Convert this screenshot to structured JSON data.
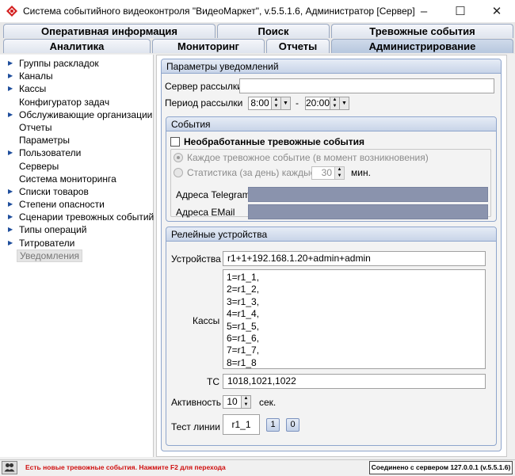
{
  "window": {
    "title": "Система событийного видеоконтроля \"ВидеоМаркет\", v.5.5.1.6, Администратор  [Сервер]",
    "minimize": "–",
    "maximize": "☐",
    "close": "✕"
  },
  "tabs_row1": [
    "Оперативная информация",
    "Поиск",
    "Тревожные события"
  ],
  "tabs_row2": [
    "Аналитика",
    "Мониторинг",
    "Отчеты",
    "Администрирование"
  ],
  "active_tab": "Администрирование",
  "sidebar": {
    "items": [
      {
        "label": "Группы раскладок",
        "arrow": true
      },
      {
        "label": "Каналы",
        "arrow": true
      },
      {
        "label": "Кассы",
        "arrow": true
      },
      {
        "label": "Конфигуратор задач",
        "arrow": false
      },
      {
        "label": "Обслуживающие организации",
        "arrow": true
      },
      {
        "label": "Отчеты",
        "arrow": false
      },
      {
        "label": "Параметры",
        "arrow": false
      },
      {
        "label": "Пользователи",
        "arrow": true
      },
      {
        "label": "Серверы",
        "arrow": false
      },
      {
        "label": "Система мониторинга",
        "arrow": false
      },
      {
        "label": "Списки товаров",
        "arrow": true
      },
      {
        "label": "Степени опасности",
        "arrow": true
      },
      {
        "label": "Сценарии тревожных событий",
        "arrow": true
      },
      {
        "label": "Типы операций",
        "arrow": true
      },
      {
        "label": "Титрователи",
        "arrow": true
      },
      {
        "label": "Уведомления",
        "arrow": false,
        "selected": true
      }
    ]
  },
  "notifications": {
    "header": "Параметры уведомлений",
    "server_label": "Сервер рассылки",
    "server_value": "",
    "period_label": "Период рассылки",
    "period_from": "8:00",
    "period_dash": "-",
    "period_to": "20:00"
  },
  "events": {
    "header": "События",
    "unprocessed_label": "Необработанные тревожные события",
    "unprocessed_checked": false,
    "each_label": "Каждое тревожное событие (в момент возникновения)",
    "stats_label": "Статистика (за день) каждые",
    "stats_value": "30",
    "stats_unit": "мин.",
    "telegram_label": "Адреса Telegram",
    "email_label": "Адреса EMail"
  },
  "relay": {
    "header": "Релейные устройства",
    "devices_label": "Устройства",
    "devices_value": "r1+1+192.168.1.20+admin+admin",
    "kassy_label": "Кассы",
    "kassy": [
      "1=r1_1,",
      "2=r1_2,",
      "3=r1_3,",
      "4=r1_4,",
      "5=r1_5,",
      "6=r1_6,",
      "7=r1_7,",
      "8=r1_8"
    ],
    "tc_label": "ТС",
    "tc_value": "1018,1021,1022",
    "activity_label": "Активность",
    "activity_value": "10",
    "activity_unit": "сек.",
    "test_label": "Тест линии",
    "test_value": "r1_1",
    "btn_1": "1",
    "btn_0": "0"
  },
  "statusbar": {
    "icon": "users-icon",
    "alert": "Есть новые тревожные события. Нажмите F2 для перехода",
    "connection": "Соединено с сервером 127.0.0.1 (v.5.5.1.6)"
  }
}
